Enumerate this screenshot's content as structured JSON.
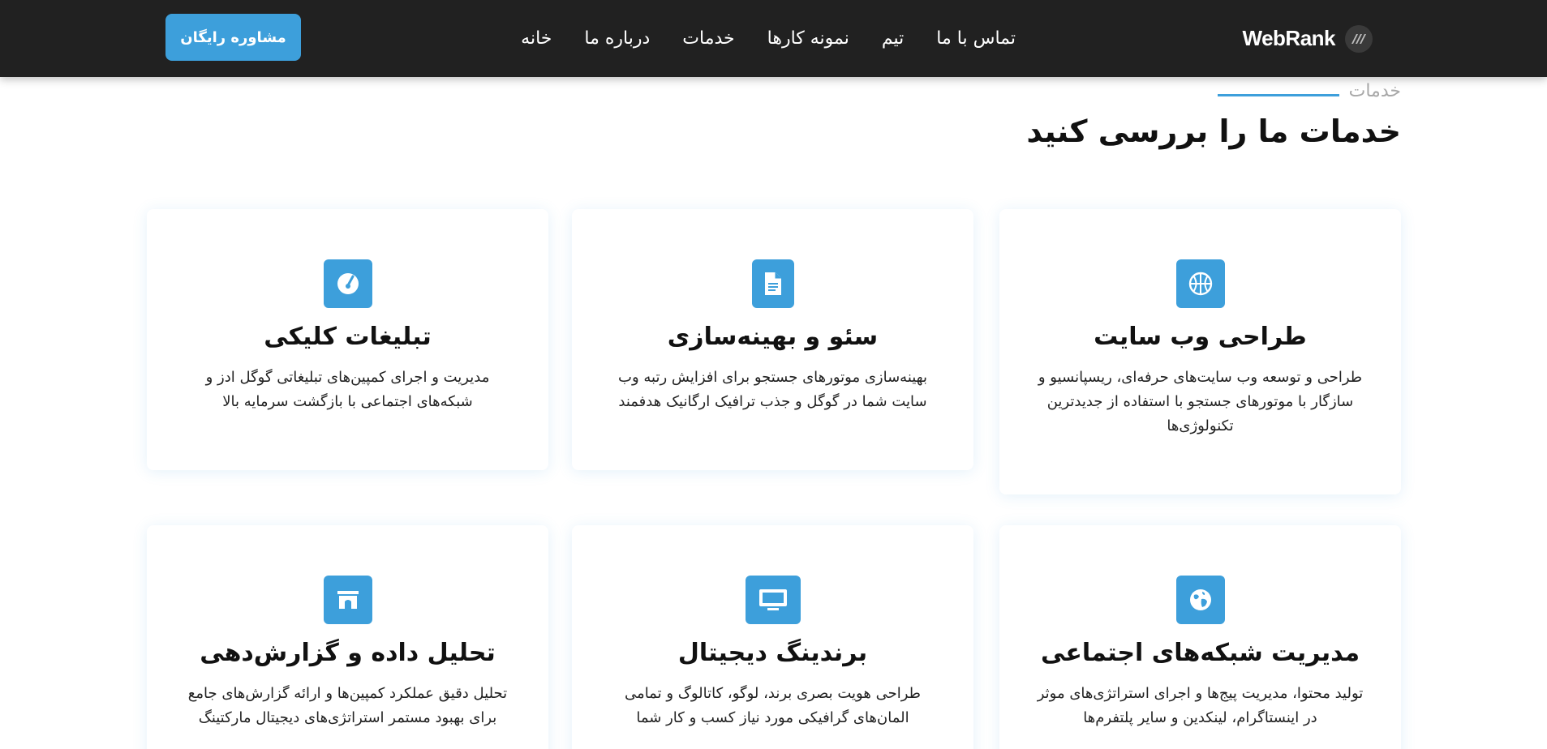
{
  "brand": {
    "name": "WebRank",
    "logo_icon": "brand-logo-icon"
  },
  "nav": {
    "items": [
      {
        "label": "خانه"
      },
      {
        "label": "درباره ما"
      },
      {
        "label": "خدمات"
      },
      {
        "label": "نمونه کارها"
      },
      {
        "label": "تیم"
      },
      {
        "label": "تماس با ما"
      }
    ],
    "cta_label": "مشاوره رایگان"
  },
  "section": {
    "eyebrow": "خدمات",
    "title": "خدمات ما را بررسی کنید"
  },
  "colors": {
    "accent": "#3d9fdb",
    "navbar": "#212121",
    "eyebrow_text": "#a8a8a8"
  },
  "services": [
    {
      "icon": "basketball-icon",
      "title": "طراحی وب سایت",
      "description": "طراحی و توسعه وب سایت‌های حرفه‌ای، ریسپانسیو و سازگار با موتورهای جستجو با استفاده از جدیدترین تکنولوژی‌ها"
    },
    {
      "icon": "document-icon",
      "title": "سئو و بهینه‌سازی",
      "description": "بهینه‌سازی موتورهای جستجو برای افزایش رتبه وب سایت شما در گوگل و جذب ترافیک ارگانیک هدفمند"
    },
    {
      "icon": "speedometer-icon",
      "title": "تبلیغات کلیکی",
      "description": "مدیریت و اجرای کمپین‌های تبلیغاتی گوگل ادز و شبکه‌های اجتماعی با بازگشت سرمایه بالا"
    },
    {
      "icon": "globe-icon",
      "title": "مدیریت شبکه‌های اجتماعی",
      "description": "تولید محتوا، مدیریت پیج‌ها و اجرای استراتژی‌های موثر در اینستاگرام، لینکدین و سایر پلتفرم‌ها"
    },
    {
      "icon": "monitor-icon",
      "title": "برندینگ دیجیتال",
      "description": "طراحی هویت بصری برند، لوگو، کاتالوگ و تمامی المان‌های گرافیکی مورد نیاز کسب و کار شما"
    },
    {
      "icon": "archway-icon",
      "title": "تحلیل داده و گزارش‌دهی",
      "description": "تحلیل دقیق عملکرد کمپین‌ها و ارائه گزارش‌های جامع برای بهبود مستمر استراتژی‌های دیجیتال مارکتینگ"
    }
  ]
}
